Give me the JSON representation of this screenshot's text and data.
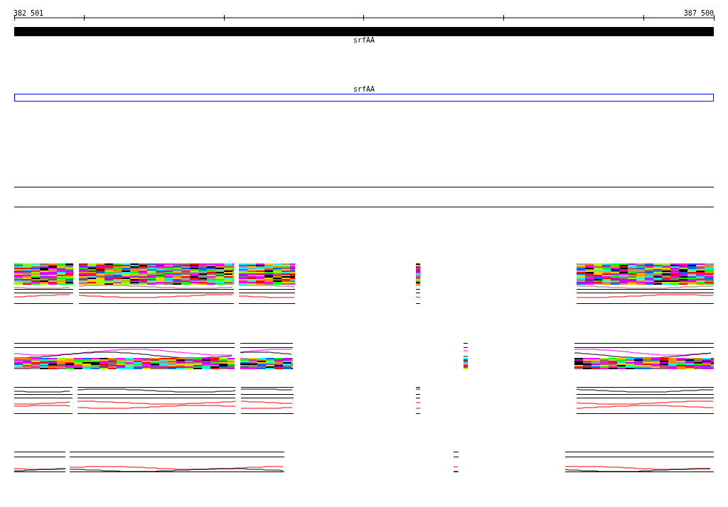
{
  "ruler": {
    "start": "382 501",
    "end": "387 500"
  },
  "tracks": [
    {
      "kind": "filled",
      "label": "srfAA"
    },
    {
      "kind": "outline",
      "label": "srfAA"
    }
  ]
}
